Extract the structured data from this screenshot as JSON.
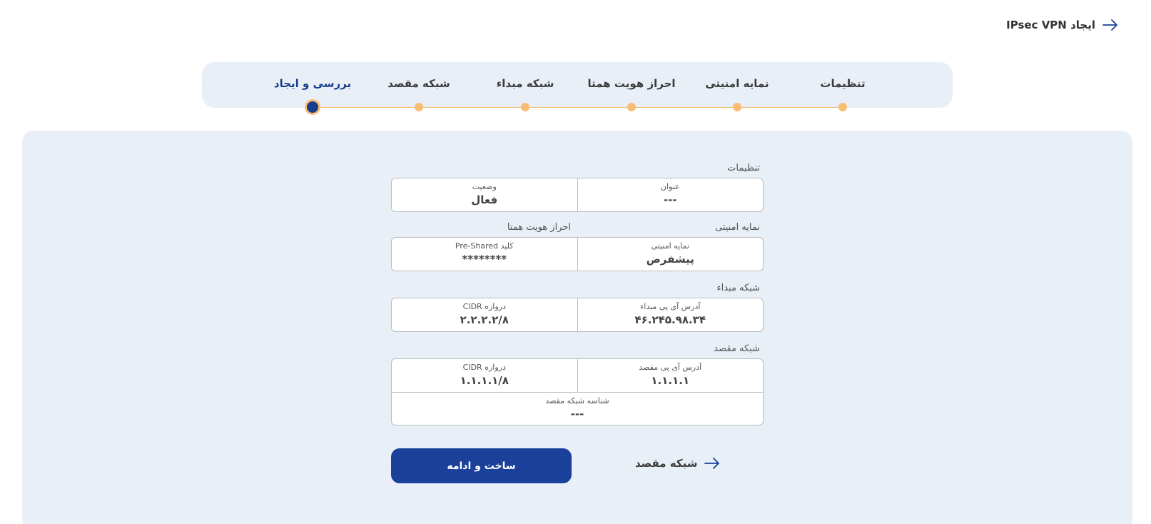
{
  "header": {
    "title": "ایجاد IPsec VPN"
  },
  "stepper": {
    "steps": [
      {
        "label": "تنظیمات"
      },
      {
        "label": "نمایه امنیتی"
      },
      {
        "label": "احراز هویت همتا"
      },
      {
        "label": "شبکه مبداء"
      },
      {
        "label": "شبکه مقصد"
      },
      {
        "label": "بررسی و ایجاد"
      }
    ],
    "active_step": "بررسی و ایجاد"
  },
  "summary": {
    "settings": {
      "section_title": "تنظیمات",
      "title_label": "عنوان",
      "title_value": "---",
      "status_label": "وضعیت",
      "status_value": "فعال"
    },
    "security": {
      "section_title": "نمایه امنیتی",
      "peer_auth_title": "احراز هویت همتا",
      "profile_label": "نمایه امنیتی",
      "profile_value": "پیشفرض",
      "psk_label": "کلید Pre-Shared",
      "psk_value": "********"
    },
    "source_network": {
      "section_title": "شبکه مبداء",
      "ip_label": "آدرس آی پی مبداء",
      "ip_value": "۴۶.۲۴۵.۹۸.۳۴",
      "cidr_label": "دروازه CIDR",
      "cidr_value": "۲.۲.۲.۲/۸"
    },
    "destination_network": {
      "section_title": "شبکه مقصد",
      "ip_label": "آدرس آی پی مقصد",
      "ip_value": "۱.۱.۱.۱",
      "cidr_label": "دروازه CIDR",
      "cidr_value": "۱.۱.۱.۱/۸",
      "network_id_label": "شناسه شبکه مقصد",
      "network_id_value": "---"
    }
  },
  "actions": {
    "create_label": "ساخت و ادامه",
    "previous_label": "شبکه مقصد"
  },
  "colors": {
    "primary": "#1a409a",
    "accent": "#f7bd74",
    "panel_bg": "#e9eff6"
  }
}
